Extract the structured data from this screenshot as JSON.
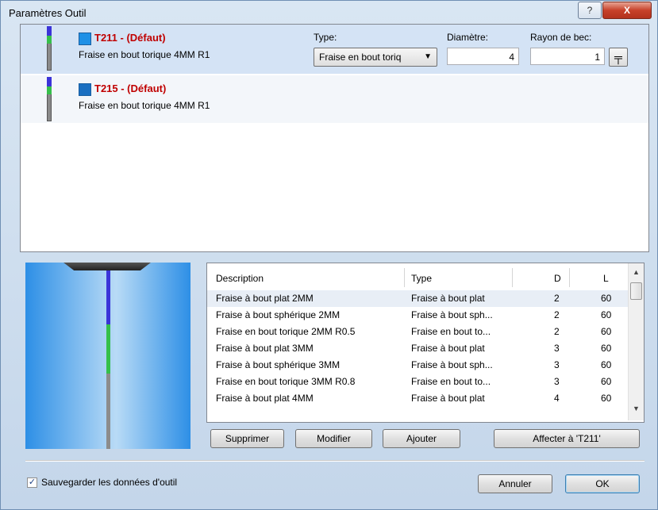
{
  "window": {
    "title": "Paramètres Outil",
    "help_glyph": "?",
    "close_glyph": "X"
  },
  "tools": [
    {
      "name": "T211 - (Défaut)",
      "description": "Fraise en bout torique 4MM R1",
      "swatch_color": "#1e90e6"
    },
    {
      "name": "T215 - (Défaut)",
      "description": "Fraise en bout torique 4MM R1",
      "swatch_color": "#1a6fc1"
    }
  ],
  "editor": {
    "type_label": "Type:",
    "type_value": "Fraise en bout toriq",
    "diameter_label": "Diamètre:",
    "diameter_value": "4",
    "radius_label": "Rayon de bec:",
    "radius_value": "1",
    "pick_glyph": "╤"
  },
  "library": {
    "columns": [
      "Description",
      "Type",
      "D",
      "L"
    ],
    "rows": [
      [
        "Fraise à bout plat 2MM",
        "Fraise à bout plat",
        "2",
        "60"
      ],
      [
        "Fraise à bout sphérique 2MM",
        "Fraise à bout sph...",
        "2",
        "60"
      ],
      [
        "Fraise en bout torique 2MM R0.5",
        "Fraise en bout to...",
        "2",
        "60"
      ],
      [
        "Fraise à bout plat 3MM",
        "Fraise à bout plat",
        "3",
        "60"
      ],
      [
        "Fraise à bout sphérique 3MM",
        "Fraise à bout sph...",
        "3",
        "60"
      ],
      [
        "Fraise en bout torique 3MM R0.8",
        "Fraise en bout to...",
        "3",
        "60"
      ],
      [
        "Fraise à bout plat 4MM",
        "Fraise à bout plat",
        "4",
        "60"
      ]
    ]
  },
  "buttons": {
    "delete": "Supprimer",
    "modify": "Modifier",
    "add": "Ajouter",
    "assign": "Affecter à 'T211'",
    "cancel": "Annuler",
    "ok": "OK"
  },
  "save_checkbox": {
    "label": "Sauvegarder les données d'outil",
    "checked": true,
    "glyph": "✓"
  },
  "scrollbar": {
    "up": "▲",
    "down": "▼"
  },
  "dropdown_arrow": "▼"
}
